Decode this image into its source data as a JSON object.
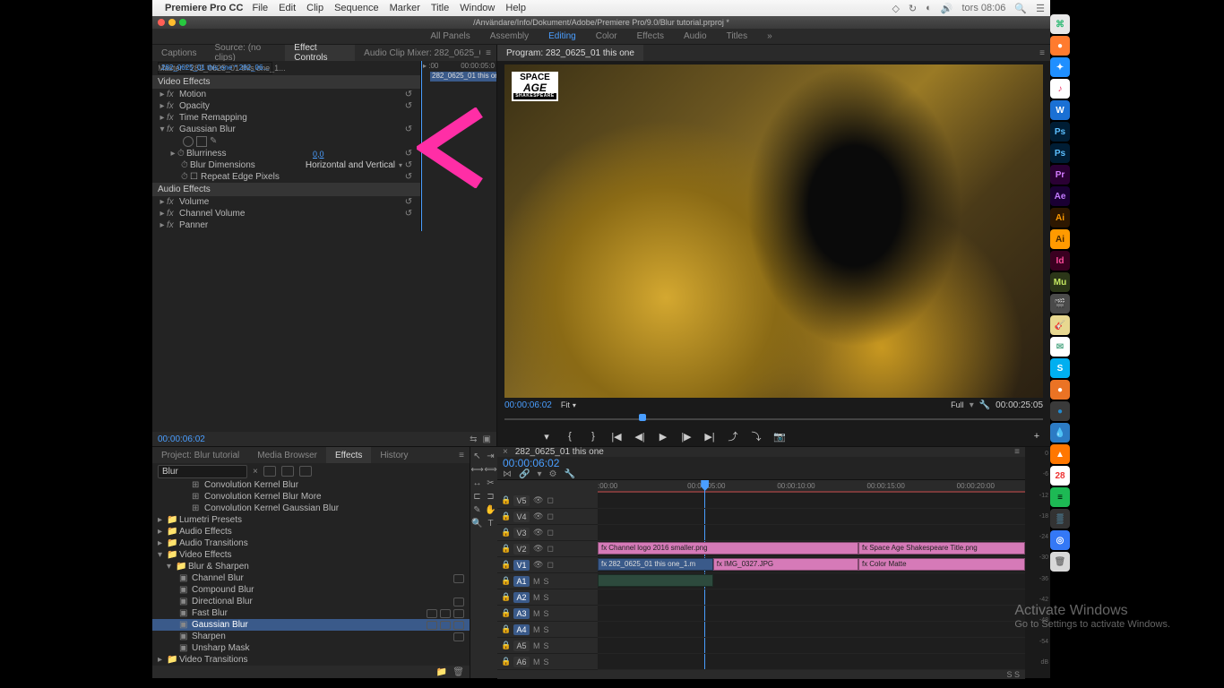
{
  "menubar": {
    "app_name": "Premiere Pro CC",
    "menus": [
      "File",
      "Edit",
      "Clip",
      "Sequence",
      "Marker",
      "Title",
      "Window",
      "Help"
    ],
    "clock": "tors 08:06"
  },
  "titlebar": {
    "path": "/Användare/Info/Dokument/Adobe/Premiere Pro/9.0/Blur tutorial.prproj *"
  },
  "workspaces": [
    "All Panels",
    "Assembly",
    "Editing",
    "Color",
    "Effects",
    "Audio",
    "Titles"
  ],
  "workspace_active": "Editing",
  "left_tabs": [
    "Captions",
    "Source: (no clips)",
    "Effect Controls",
    "Audio Clip Mixer: 282_0625_01 this o"
  ],
  "left_tab_active": "Effect Controls",
  "effect_controls": {
    "master_label": "Master * 282_0625_01 this one_1...",
    "clip_label": "282_0625_01 this one * 282_06...",
    "mini_tc_start": ":00",
    "mini_tc_end": "00:00:05:0",
    "mini_clip_name": "282_0625_01 this on",
    "section_video": "Video Effects",
    "section_audio": "Audio Effects",
    "motion": "Motion",
    "opacity": "Opacity",
    "time_remap": "Time Remapping",
    "gaussian": "Gaussian Blur",
    "blurriness": "Blurriness",
    "blurriness_val": "0,0",
    "blur_dims": "Blur Dimensions",
    "blur_dims_val": "Horizontal and Vertical",
    "repeat_edge": "Repeat Edge Pixels",
    "volume": "Volume",
    "channel_volume": "Channel Volume",
    "panner": "Panner",
    "timecode": "00:00:06:02"
  },
  "program": {
    "tab": "Program: 282_0625_01 this one",
    "timecode": "00:00:06:02",
    "fit": "Fit",
    "full": "Full",
    "duration": "00:00:25:05",
    "title_card": {
      "l1": "SPACE",
      "l2": "AGE",
      "l3": "SHAKESPEARE"
    }
  },
  "bottom_tabs": [
    "Project: Blur tutorial",
    "Media Browser",
    "Effects",
    "History"
  ],
  "bottom_tab_active": "Effects",
  "effects_panel": {
    "search": "Blur",
    "items_top": [
      "Convolution Kernel Blur",
      "Convolution Kernel Blur More",
      "Convolution Kernel Gaussian Blur"
    ],
    "folders": [
      "Lumetri Presets",
      "Audio Effects",
      "Audio Transitions",
      "Video Effects"
    ],
    "blur_sharpen": "Blur & Sharpen",
    "blur_items": [
      "Channel Blur",
      "Compound Blur",
      "Directional Blur",
      "Fast Blur",
      "Gaussian Blur",
      "Sharpen",
      "Unsharp Mask"
    ],
    "selected": "Gaussian Blur",
    "video_transitions": "Video Transitions"
  },
  "timeline": {
    "seq_name": "282_0625_01 this one",
    "timecode": "00:00:06:02",
    "ruler": [
      ":00:00",
      "00:00:05:00",
      "00:00:10:00",
      "00:00:15:00",
      "00:00:20:00"
    ],
    "video_tracks": [
      "V5",
      "V4",
      "V3",
      "V2",
      "V1"
    ],
    "audio_tracks": [
      "A1",
      "A2",
      "A3",
      "A4",
      "A5",
      "A6"
    ],
    "clips": {
      "v2_a": "Channel logo 2016 smaller.png",
      "v2_b": "Space Age Shakespeare Title.png",
      "v1_a": "282_0625_01 this one_1.m",
      "v1_b": "IMG_0327.JPG",
      "v1_c": "Color Matte"
    },
    "footer_s": "S   S"
  },
  "meter_labels": [
    "0",
    "-6",
    "-12",
    "-18",
    "-24",
    "-30",
    "-36",
    "-42",
    "-48",
    "-54",
    "dB"
  ],
  "dock": [
    {
      "bg": "#e8e8e8",
      "fg": "#3b7",
      "txt": "⌘"
    },
    {
      "bg": "#ff7b2e",
      "fg": "#fff",
      "txt": "●"
    },
    {
      "bg": "#1f8fff",
      "fg": "#fff",
      "txt": "✦"
    },
    {
      "bg": "#fff",
      "fg": "#e36",
      "txt": "♪"
    },
    {
      "bg": "#1a70d4",
      "fg": "#fff",
      "txt": "W"
    },
    {
      "bg": "#001d34",
      "fg": "#5bbfff",
      "txt": "Ps"
    },
    {
      "bg": "#001d34",
      "fg": "#5bbfff",
      "txt": "Ps"
    },
    {
      "bg": "#2a0033",
      "fg": "#d47bff",
      "txt": "Pr"
    },
    {
      "bg": "#1a0033",
      "fg": "#c47bff",
      "txt": "Ae"
    },
    {
      "bg": "#2d1700",
      "fg": "#ff9a00",
      "txt": "Ai"
    },
    {
      "bg": "#ff9a00",
      "fg": "#4a2800",
      "txt": "Ai"
    },
    {
      "bg": "#3a0020",
      "fg": "#ff4b9b",
      "txt": "Id"
    },
    {
      "bg": "#2b3618",
      "fg": "#c4e861",
      "txt": "Mu"
    },
    {
      "bg": "#4a4a4a",
      "fg": "#ddd",
      "txt": "🎬"
    },
    {
      "bg": "#e8d890",
      "fg": "#8a5",
      "txt": "🎸"
    },
    {
      "bg": "#fff",
      "fg": "#5a8",
      "txt": "✉"
    },
    {
      "bg": "#00aff0",
      "fg": "#fff",
      "txt": "S"
    },
    {
      "bg": "#eb7324",
      "fg": "#fff",
      "txt": "●"
    },
    {
      "bg": "#3a3a3a",
      "fg": "#28c",
      "txt": "●"
    },
    {
      "bg": "#2c7bc4",
      "fg": "#fff",
      "txt": "💧"
    },
    {
      "bg": "#ff7700",
      "fg": "#fff",
      "txt": "▲"
    },
    {
      "bg": "#fff",
      "fg": "#e33",
      "txt": "28"
    },
    {
      "bg": "#1db954",
      "fg": "#000",
      "txt": "≡"
    },
    {
      "bg": "#333",
      "fg": "#6cf",
      "txt": "▒"
    },
    {
      "bg": "#3478f6",
      "fg": "#fff",
      "txt": "◎"
    },
    {
      "bg": "#d8d8d8",
      "fg": "#777",
      "txt": "🗑"
    }
  ],
  "activate": {
    "title": "Activate Windows",
    "sub": "Go to Settings to activate Windows."
  }
}
